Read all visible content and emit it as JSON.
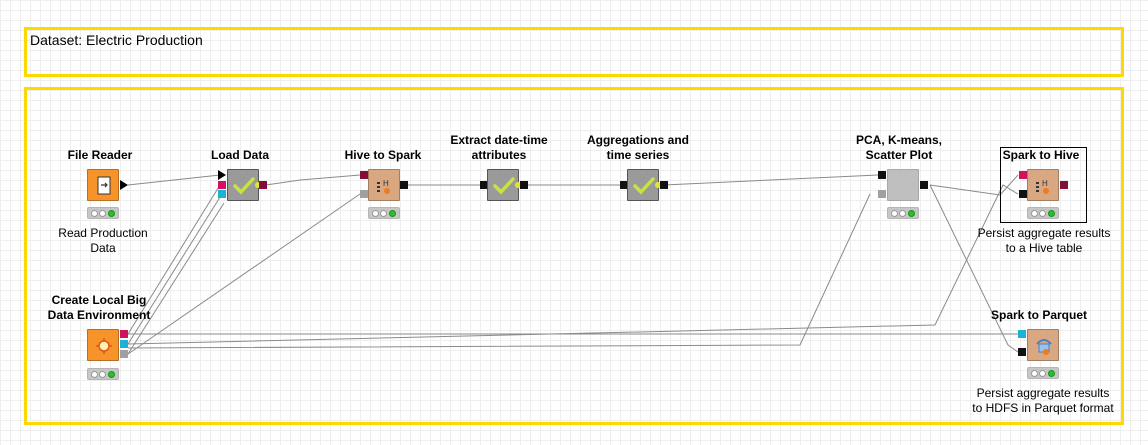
{
  "annotations": {
    "dataset_label": "Dataset: Electric Production"
  },
  "nodes": {
    "file_reader": {
      "title": "File Reader",
      "caption_line1": "Read Production",
      "caption_line2": "Data",
      "icon": "file-reader-icon"
    },
    "load_data": {
      "title": "Load Data",
      "icon": "check-icon"
    },
    "hive_to_spark": {
      "title": "Hive to Spark",
      "icon": "hive-spark-icon"
    },
    "extract_datetime": {
      "title_line1": "Extract date-time",
      "title_line2": "attributes",
      "icon": "check-icon"
    },
    "aggregations": {
      "title_line1": "Aggregations and",
      "title_line2": "time series",
      "icon": "check-icon"
    },
    "pca_kmeans": {
      "title_line1": "PCA, K-means,",
      "title_line2": "Scatter Plot",
      "icon": "metanode-icon"
    },
    "spark_to_hive": {
      "title": "Spark to Hive",
      "caption_line1": "Persist aggregate results",
      "caption_line2": "to a Hive table",
      "icon": "spark-hive-icon"
    },
    "create_env": {
      "title_line1": "Create Local Big",
      "title_line2": "Data Environment",
      "icon": "big-data-environment-icon"
    },
    "spark_to_parquet": {
      "title": "Spark to Parquet",
      "caption_line1": "Persist aggregate results",
      "caption_line2": "to HDFS in Parquet format",
      "icon": "parquet-icon"
    }
  },
  "colors": {
    "annotation_border": "#ffd800",
    "source_node": "#f7932b",
    "manipulator_node": "#f3e23a",
    "metanode": "#9a9a9a",
    "db_node": "#d9a882",
    "success_lamp": "#2bc02b",
    "check_mark": "#c8e43c"
  }
}
